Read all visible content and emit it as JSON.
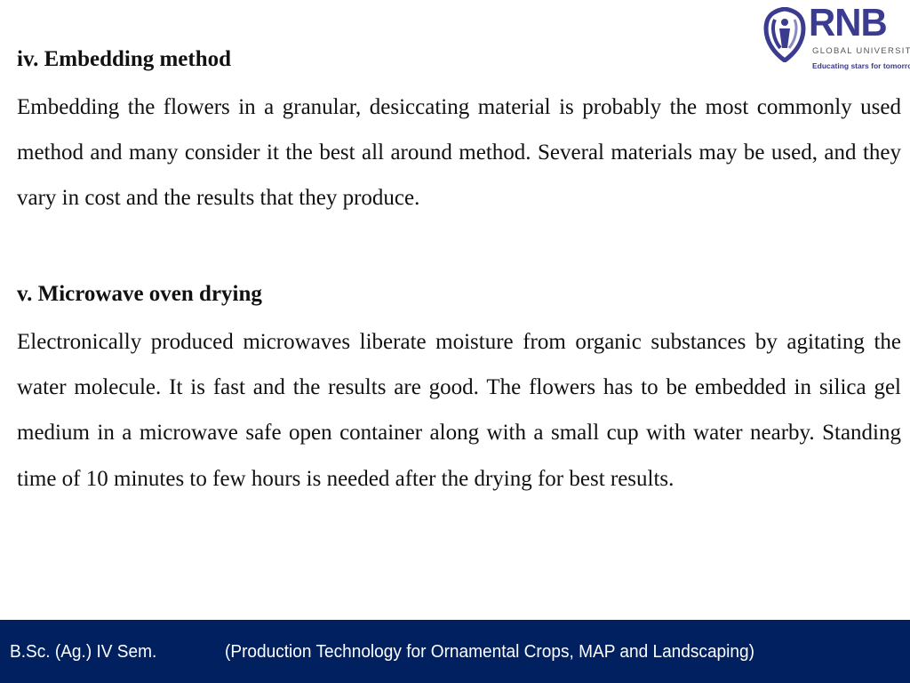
{
  "logo": {
    "icon": "shield-person-icon",
    "name": "RNB",
    "subtitle": "GLOBAL UNIVERSITY",
    "tagline": "Educating stars for tomorrow",
    "brand_color": "#3b3b8f"
  },
  "sections": [
    {
      "heading": "iv. Embedding method",
      "body": "Embedding the flowers in a granular, desiccating material is probably the most commonly used method and many consider it the best all around method. Several materials may be used, and they vary in cost and the results that they produce."
    },
    {
      "heading": "v. Microwave oven drying",
      "body": "Electronically produced microwaves liberate moisture from organic substances by agitating the water molecule. It is fast and the results are good. The flowers has to be embedded in silica gel medium in a microwave safe open container along with a small cup with water nearby. Standing time of 10 minutes to few hours is needed after the drying for best results."
    }
  ],
  "footer": {
    "course": "B.Sc. (Ag.) IV Sem.",
    "subject": "(Production Technology for Ornamental Crops, MAP and Landscaping)",
    "background_color": "#002060"
  }
}
